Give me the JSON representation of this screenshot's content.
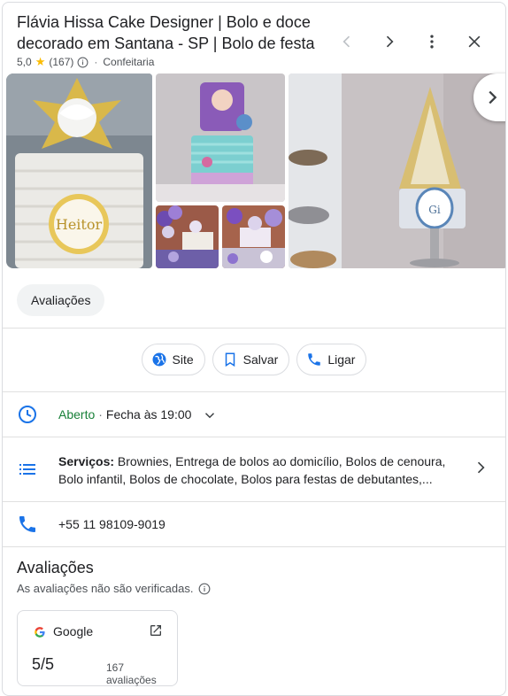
{
  "header": {
    "title": "Flávia Hissa Cake Designer | Bolo e doce decorado em Santana - SP | Bolo de festa",
    "rating": "5,0",
    "review_count": "(167)",
    "category": "Confeitaria",
    "star_color": "#fbbc04"
  },
  "photos": {
    "cake_topper_text": "Heitor",
    "plaque_text": "Gi"
  },
  "tabs": {
    "reviews_chip": "Avaliações"
  },
  "actions": {
    "site_label": "Site",
    "save_label": "Salvar",
    "call_label": "Ligar"
  },
  "hours": {
    "status": "Aberto",
    "separator": "·",
    "closes": "Fecha às 19:00"
  },
  "services": {
    "label": "Serviços:",
    "text": " Brownies, Entrega de bolos ao domicílio, Bolos de cenoura, Bolo infantil, Bolos de chocolate, Bolos para festas de debutantes,..."
  },
  "phone": {
    "number": "+55 11 98109-9019"
  },
  "reviews": {
    "title": "Avaliações",
    "note": "As avaliações não são verificadas.",
    "card": {
      "source": "Google",
      "score": "5/5",
      "count": "167 avaliações"
    }
  },
  "colors": {
    "accent_blue": "#1a73e8",
    "open_green": "#188038",
    "text": "#202124",
    "muted": "#4d5156"
  },
  "icons": [
    "chevron-left-icon",
    "chevron-right-icon",
    "more-vert-icon",
    "close-icon",
    "info-icon",
    "globe-icon",
    "bookmark-icon",
    "phone-icon",
    "clock-icon",
    "list-icon",
    "chevron-down-icon",
    "google-logo-icon",
    "open-in-new-icon"
  ]
}
